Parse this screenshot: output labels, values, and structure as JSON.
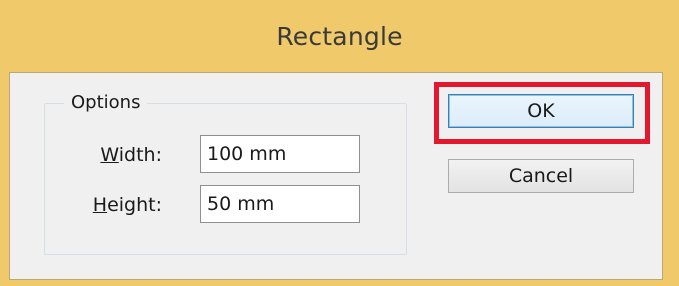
{
  "window": {
    "title": "Rectangle"
  },
  "options": {
    "group_label": "Options",
    "width": {
      "label_prefix": "W",
      "label_rest": "idth:",
      "value": "100 mm"
    },
    "height": {
      "label_prefix": "H",
      "label_rest": "eight:",
      "value": "50 mm"
    }
  },
  "buttons": {
    "ok_label": "OK",
    "cancel_label": "Cancel"
  },
  "colors": {
    "titlebar": "#f0c96a",
    "dialog_bg": "#f0f0f0",
    "highlight": "#e3172e"
  }
}
